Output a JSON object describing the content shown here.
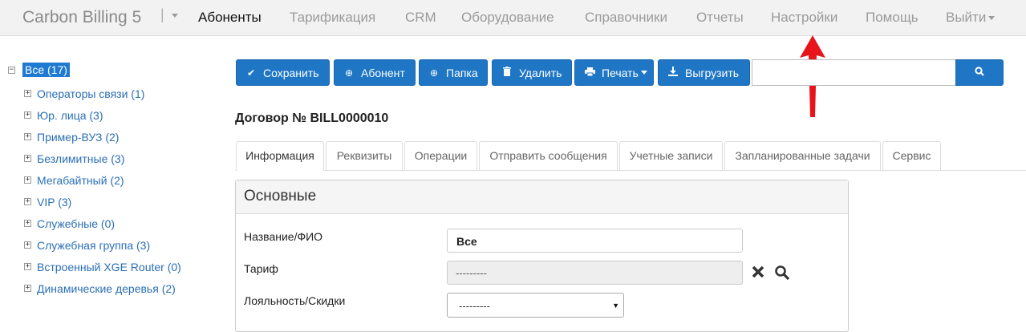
{
  "navbar": {
    "brand": "Carbon Billing 5",
    "separator": "|",
    "items": [
      {
        "label": "Абоненты",
        "active": true
      },
      {
        "label": "Тарификация"
      },
      {
        "label": "CRM"
      },
      {
        "label": "Оборудование"
      },
      {
        "label": "Справочники"
      },
      {
        "label": "Отчеты"
      },
      {
        "label": "Настройки"
      },
      {
        "label": "Помощь"
      },
      {
        "label": "Выйти"
      }
    ]
  },
  "tree": {
    "root": {
      "label": "Все (17)",
      "toggle": "−"
    },
    "items": [
      {
        "label": "Операторы связи (1)",
        "toggle": "+"
      },
      {
        "label": "Юр. лица (3)",
        "toggle": "+"
      },
      {
        "label": "Пример-ВУЗ (2)",
        "toggle": "+"
      },
      {
        "label": "Безлимитные (3)",
        "toggle": "+"
      },
      {
        "label": "Мегабайтный (2)",
        "toggle": "+"
      },
      {
        "label": "VIP (3)",
        "toggle": "+"
      },
      {
        "label": "Служебные (0)",
        "toggle": "+"
      },
      {
        "label": "Служебная группа (3)",
        "toggle": "+"
      },
      {
        "label": "Встроенный XGE Router (0)",
        "toggle": "+"
      },
      {
        "label": "Динамические деревья (2)",
        "toggle": "+"
      }
    ]
  },
  "toolbar": {
    "save": "Сохранить",
    "subscriber": "Абонент",
    "folder": "Папка",
    "delete": "Удалить",
    "print": "Печать",
    "export": "Выгрузить",
    "search_value": ""
  },
  "icons": {
    "save": "check-icon",
    "subscriber": "plus-circle-icon",
    "folder": "plus-circle-icon",
    "delete": "trash-icon",
    "print": "printer-icon",
    "export": "download-icon",
    "search": "search-icon",
    "clear": "close-icon",
    "lookup": "search-icon"
  },
  "contract": {
    "title": "Договор № BILL0000010"
  },
  "tabs": [
    {
      "label": "Информация",
      "active": true
    },
    {
      "label": "Реквизиты"
    },
    {
      "label": "Операции"
    },
    {
      "label": "Отправить сообщения"
    },
    {
      "label": "Учетные записи"
    },
    {
      "label": "Запланированные задачи"
    },
    {
      "label": "Сервис"
    }
  ],
  "panel": {
    "title": "Основные",
    "fields": {
      "name": {
        "label": "Название/ФИО",
        "value": "Все"
      },
      "tariff": {
        "label": "Тариф",
        "value": "---------"
      },
      "loyalty": {
        "label": "Лояльность/Скидки",
        "value": "---------"
      }
    }
  },
  "colors": {
    "primary": "#1f76c5",
    "link": "#2a6fb5",
    "selected": "#1f7bd2",
    "annotation_arrow": "#e8141c"
  }
}
